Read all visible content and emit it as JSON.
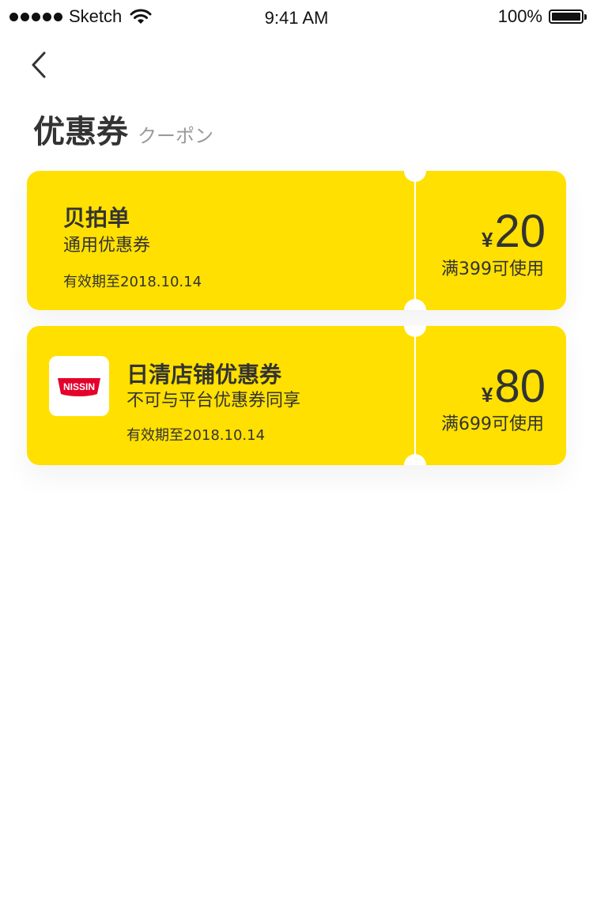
{
  "status_bar": {
    "carrier": "Sketch",
    "time": "9:41 AM",
    "battery": "100%"
  },
  "header": {
    "title": "优惠券",
    "subtitle": "クーポン"
  },
  "coupons": [
    {
      "name": "贝拍单",
      "description": "通用优惠券",
      "validity": "有效期至2018.10.14",
      "currency": "¥",
      "amount": "20",
      "threshold": "满399可使用"
    },
    {
      "name": "日清店铺优惠券",
      "description": "不可与平台优惠券同享",
      "validity": "有效期至2018.10.14",
      "currency": "¥",
      "amount": "80",
      "threshold": "满699可使用",
      "logo_text": "NISSIN"
    }
  ],
  "colors": {
    "coupon_bg": "#ffe000",
    "text": "#333333",
    "subtle": "#9a9a9a",
    "logo_red": "#e4002b"
  }
}
